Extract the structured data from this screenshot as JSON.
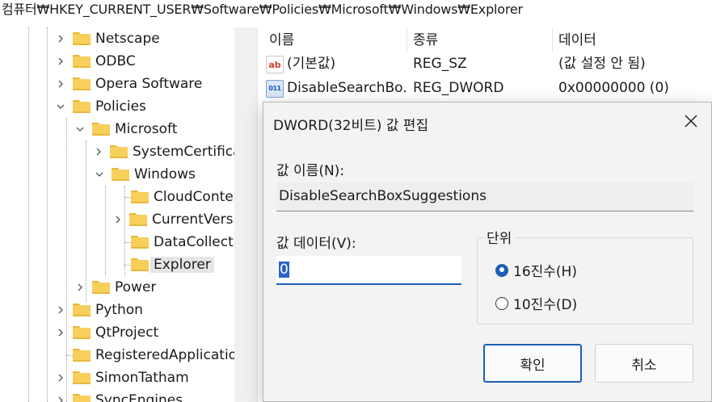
{
  "address_bar": {
    "path": "컴퓨터₩HKEY_CURRENT_USER₩Software₩Policies₩Microsoft₩Windows₩Explorer"
  },
  "tree": {
    "items": [
      {
        "label": "Netscape"
      },
      {
        "label": "ODBC"
      },
      {
        "label": "Opera Software"
      },
      {
        "label": "Policies"
      },
      {
        "label": "Microsoft"
      },
      {
        "label": "SystemCertificates"
      },
      {
        "label": "Windows"
      },
      {
        "label": "CloudContent"
      },
      {
        "label": "CurrentVersion"
      },
      {
        "label": "DataCollection"
      },
      {
        "label": "Explorer"
      },
      {
        "label": "Power"
      },
      {
        "label": "Python"
      },
      {
        "label": "QtProject"
      },
      {
        "label": "RegisteredApplications"
      },
      {
        "label": "SimonTatham"
      },
      {
        "label": "SyncEngines"
      }
    ]
  },
  "list": {
    "columns": {
      "name": "이름",
      "type": "종류",
      "data": "데이터"
    },
    "rows": [
      {
        "name": "(기본값)",
        "type": "REG_SZ",
        "data": "(값 설정 안 됨)",
        "icon": "ab"
      },
      {
        "name": "DisableSearchBo...",
        "type": "REG_DWORD",
        "data": "0x00000000 (0)",
        "icon": "011"
      }
    ]
  },
  "dialog": {
    "title": "DWORD(32비트) 값 편집",
    "value_name_label": "값 이름(N):",
    "value_name": "DisableSearchBoxSuggestions",
    "value_data_label": "값 데이터(V):",
    "value_data": "0",
    "base_label": "단위",
    "radio_hex": "16진수(H)",
    "radio_dec": "10진수(D)",
    "ok": "확인",
    "cancel": "취소"
  }
}
